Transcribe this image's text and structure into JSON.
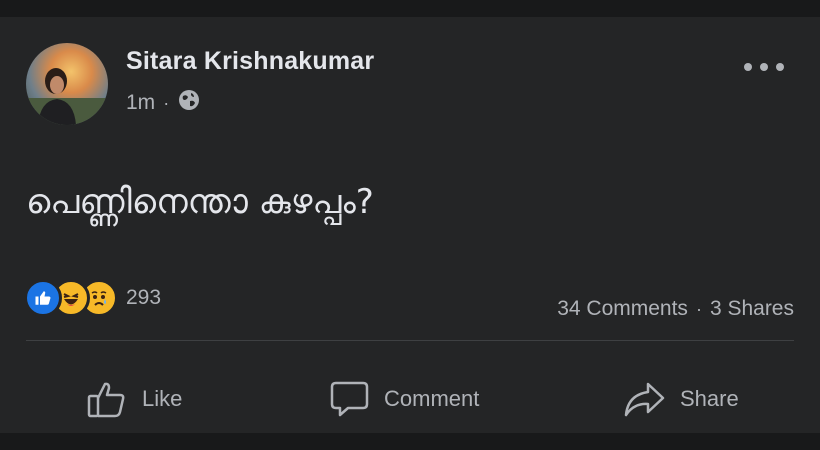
{
  "post": {
    "author": "Sitara Krishnakumar",
    "time": "1m",
    "separator": "·",
    "text": "പെണ്ണിനെന്താ കുഴപ്പം?"
  },
  "reactions": {
    "types": [
      "like",
      "haha",
      "sad"
    ],
    "count": "293"
  },
  "stats": {
    "comments": "34 Comments",
    "separator": "·",
    "shares": "3 Shares"
  },
  "actions": {
    "like": "Like",
    "comment": "Comment",
    "share": "Share"
  },
  "colors": {
    "background": "#18191a",
    "card": "#242526",
    "text_primary": "#e4e6eb",
    "text_secondary": "#b0b3b8",
    "like_blue": "#1b74e4",
    "emoji_yellow": "#f7b928"
  }
}
